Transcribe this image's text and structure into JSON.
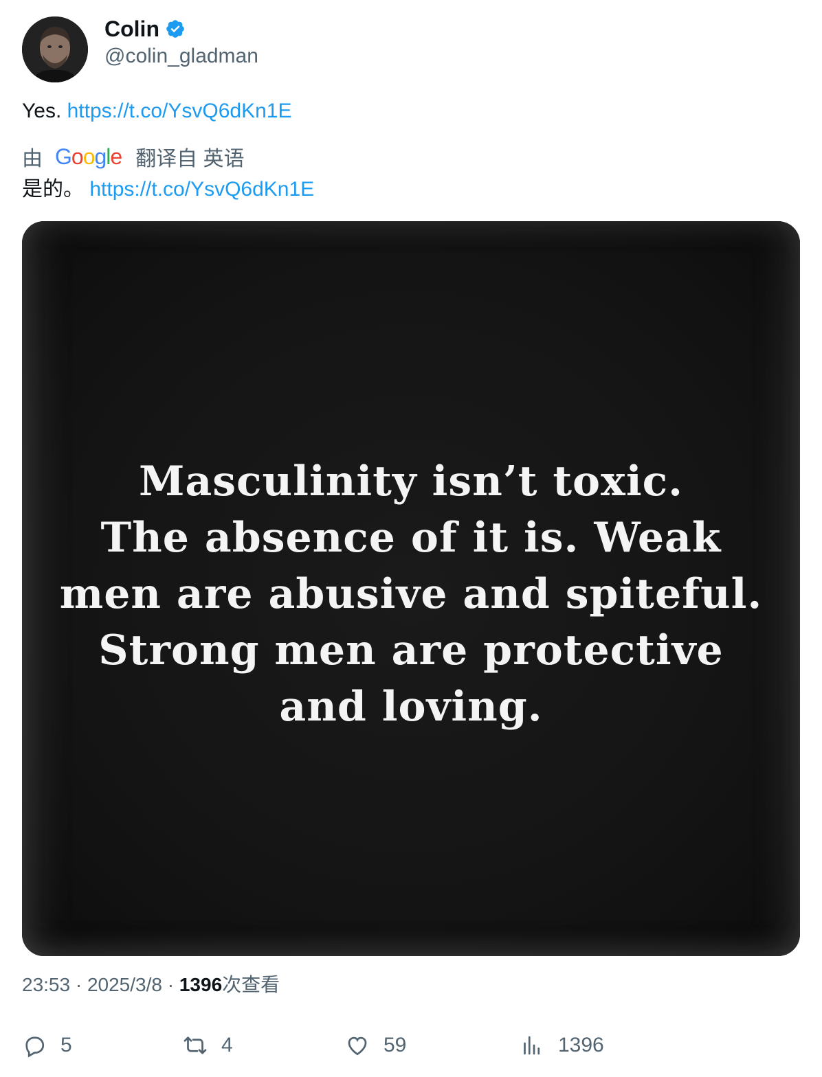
{
  "author": {
    "display_name": "Colin",
    "handle": "@colin_gladman",
    "verified_icon": "verified-badge-icon"
  },
  "tweet": {
    "text": "Yes.",
    "link": "https://t.co/YsvQ6dKn1E"
  },
  "translation": {
    "by": "由",
    "provider_logo": "Google",
    "label": "翻译自 英语",
    "text": "是的。",
    "link": "https://t.co/YsvQ6dKn1E"
  },
  "media": {
    "quote_lines": [
      "Masculinity isn’t toxic.",
      "The absence of it is. Weak",
      "men are abusive and spiteful.",
      "Strong men are protective",
      "and loving."
    ]
  },
  "meta": {
    "time": "23:53",
    "sep1": "·",
    "date": "2025/3/8",
    "sep2": "·",
    "views_count": "1396",
    "views_label": "次查看"
  },
  "actions": {
    "replies": "5",
    "retweets": "4",
    "likes": "59",
    "views": "1396"
  },
  "colors": {
    "link": "#1d9bf0",
    "secondary_text": "#536471",
    "verified": "#1d9bf0"
  }
}
